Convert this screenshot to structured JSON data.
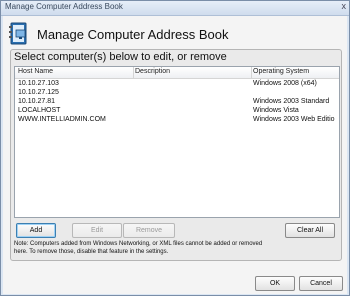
{
  "window": {
    "title": "Manage Computer Address Book",
    "close_glyph": "x"
  },
  "header": {
    "title": "Manage Computer Address Book",
    "icon": "address-book-icon"
  },
  "panel": {
    "label": "Select computer(s) below to edit, or remove"
  },
  "table": {
    "columns": [
      "Host Name",
      "Description",
      "Operating System"
    ],
    "rows": [
      {
        "host": "10.10.27.103",
        "description": "",
        "os": "Windows 2008 (x64)"
      },
      {
        "host": "10.10.27.125",
        "description": "",
        "os": ""
      },
      {
        "host": "10.10.27.81",
        "description": "",
        "os": "Windows 2003 Standard"
      },
      {
        "host": "LOCALHOST",
        "description": "",
        "os": "Windows Vista"
      },
      {
        "host": "WWW.INTELLIADMIN.COM",
        "description": "",
        "os": "Windows 2003 Web Editio"
      }
    ]
  },
  "buttons": {
    "add": "Add",
    "edit": "Edit",
    "remove": "Remove",
    "clear_all": "Clear All",
    "ok": "OK",
    "cancel": "Cancel"
  },
  "note": "Note: Computers added from Windows Networking, or XML files cannot be added or removed here. To remove those, disable that feature in the settings."
}
